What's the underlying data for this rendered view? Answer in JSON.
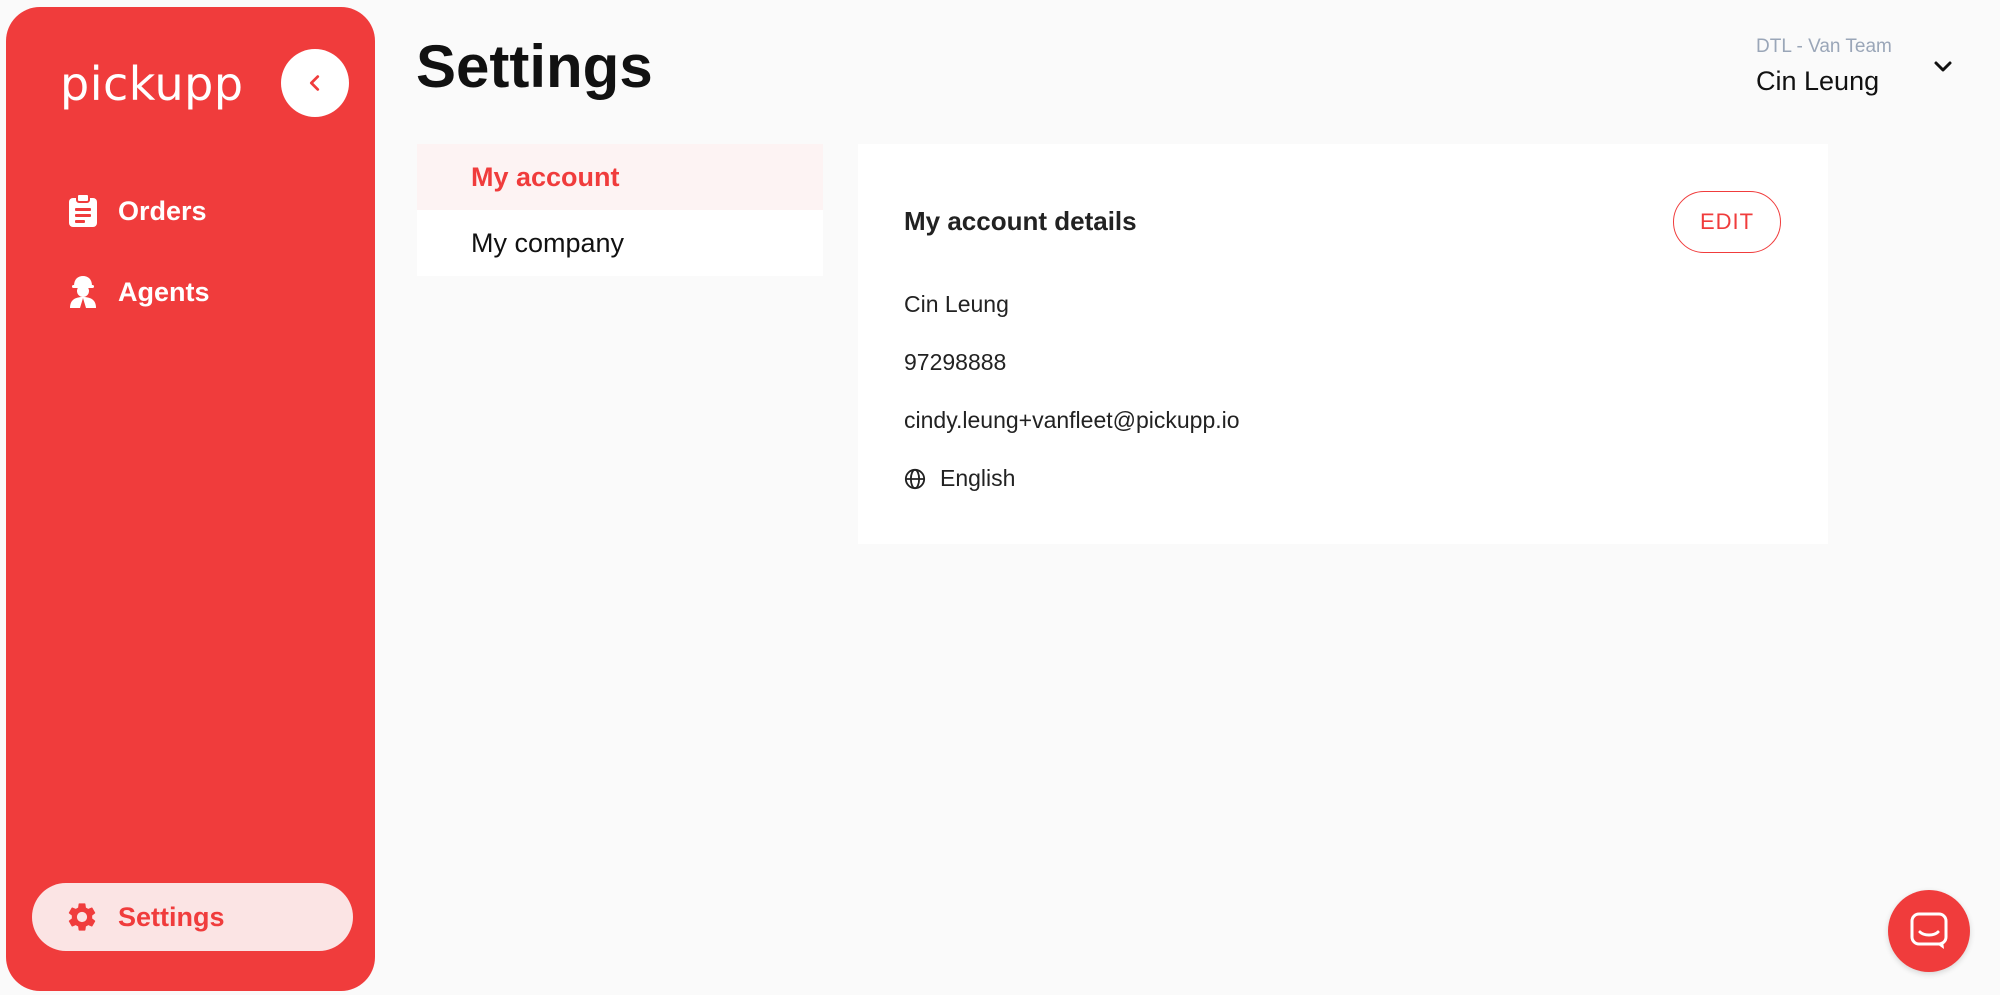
{
  "brand": {
    "logo_text": "pickupp",
    "accent_color": "#f03c3c"
  },
  "sidebar": {
    "collapse_icon": "chevron-left-icon",
    "items": [
      {
        "label": "Orders",
        "icon": "clipboard-icon"
      },
      {
        "label": "Agents",
        "icon": "agent-icon"
      }
    ],
    "settings": {
      "label": "Settings",
      "icon": "gear-icon",
      "active": true
    }
  },
  "header": {
    "title": "Settings",
    "user": {
      "team": "DTL - Van Team",
      "name": "Cin Leung",
      "dropdown_icon": "chevron-down-icon"
    }
  },
  "subnav": {
    "items": [
      {
        "label": "My account",
        "active": true
      },
      {
        "label": "My company",
        "active": false
      }
    ]
  },
  "account": {
    "title": "My account details",
    "edit_label": "EDIT",
    "name": "Cin Leung",
    "phone": "97298888",
    "email": "cindy.leung+vanfleet@pickupp.io",
    "language": "English",
    "language_icon": "globe-icon"
  },
  "chat": {
    "icon": "chat-icon"
  }
}
